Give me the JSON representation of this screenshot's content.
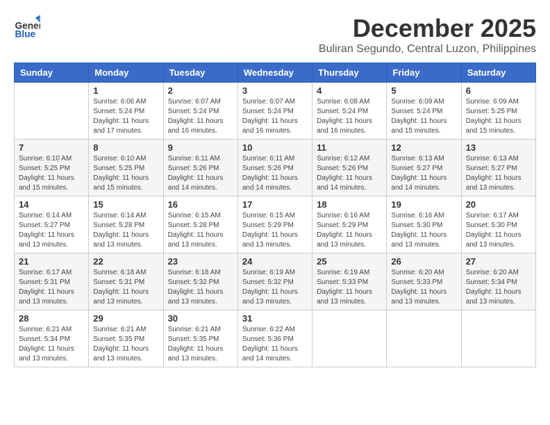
{
  "logo": {
    "line1": "General",
    "line2": "Blue"
  },
  "title": "December 2025",
  "subtitle": "Buliran Segundo, Central Luzon, Philippines",
  "headers": [
    "Sunday",
    "Monday",
    "Tuesday",
    "Wednesday",
    "Thursday",
    "Friday",
    "Saturday"
  ],
  "weeks": [
    [
      {
        "num": "",
        "info": ""
      },
      {
        "num": "1",
        "info": "Sunrise: 6:06 AM\nSunset: 5:24 PM\nDaylight: 11 hours\nand 17 minutes."
      },
      {
        "num": "2",
        "info": "Sunrise: 6:07 AM\nSunset: 5:24 PM\nDaylight: 11 hours\nand 16 minutes."
      },
      {
        "num": "3",
        "info": "Sunrise: 6:07 AM\nSunset: 5:24 PM\nDaylight: 11 hours\nand 16 minutes."
      },
      {
        "num": "4",
        "info": "Sunrise: 6:08 AM\nSunset: 5:24 PM\nDaylight: 11 hours\nand 16 minutes."
      },
      {
        "num": "5",
        "info": "Sunrise: 6:09 AM\nSunset: 5:24 PM\nDaylight: 11 hours\nand 15 minutes."
      },
      {
        "num": "6",
        "info": "Sunrise: 6:09 AM\nSunset: 5:25 PM\nDaylight: 11 hours\nand 15 minutes."
      }
    ],
    [
      {
        "num": "7",
        "info": "Sunrise: 6:10 AM\nSunset: 5:25 PM\nDaylight: 11 hours\nand 15 minutes."
      },
      {
        "num": "8",
        "info": "Sunrise: 6:10 AM\nSunset: 5:25 PM\nDaylight: 11 hours\nand 15 minutes."
      },
      {
        "num": "9",
        "info": "Sunrise: 6:11 AM\nSunset: 5:26 PM\nDaylight: 11 hours\nand 14 minutes."
      },
      {
        "num": "10",
        "info": "Sunrise: 6:11 AM\nSunset: 5:26 PM\nDaylight: 11 hours\nand 14 minutes."
      },
      {
        "num": "11",
        "info": "Sunrise: 6:12 AM\nSunset: 5:26 PM\nDaylight: 11 hours\nand 14 minutes."
      },
      {
        "num": "12",
        "info": "Sunrise: 6:13 AM\nSunset: 5:27 PM\nDaylight: 11 hours\nand 14 minutes."
      },
      {
        "num": "13",
        "info": "Sunrise: 6:13 AM\nSunset: 5:27 PM\nDaylight: 11 hours\nand 13 minutes."
      }
    ],
    [
      {
        "num": "14",
        "info": "Sunrise: 6:14 AM\nSunset: 5:27 PM\nDaylight: 11 hours\nand 13 minutes."
      },
      {
        "num": "15",
        "info": "Sunrise: 6:14 AM\nSunset: 5:28 PM\nDaylight: 11 hours\nand 13 minutes."
      },
      {
        "num": "16",
        "info": "Sunrise: 6:15 AM\nSunset: 5:28 PM\nDaylight: 11 hours\nand 13 minutes."
      },
      {
        "num": "17",
        "info": "Sunrise: 6:15 AM\nSunset: 5:29 PM\nDaylight: 11 hours\nand 13 minutes."
      },
      {
        "num": "18",
        "info": "Sunrise: 6:16 AM\nSunset: 5:29 PM\nDaylight: 11 hours\nand 13 minutes."
      },
      {
        "num": "19",
        "info": "Sunrise: 6:16 AM\nSunset: 5:30 PM\nDaylight: 11 hours\nand 13 minutes."
      },
      {
        "num": "20",
        "info": "Sunrise: 6:17 AM\nSunset: 5:30 PM\nDaylight: 11 hours\nand 13 minutes."
      }
    ],
    [
      {
        "num": "21",
        "info": "Sunrise: 6:17 AM\nSunset: 5:31 PM\nDaylight: 11 hours\nand 13 minutes."
      },
      {
        "num": "22",
        "info": "Sunrise: 6:18 AM\nSunset: 5:31 PM\nDaylight: 11 hours\nand 13 minutes."
      },
      {
        "num": "23",
        "info": "Sunrise: 6:18 AM\nSunset: 5:32 PM\nDaylight: 11 hours\nand 13 minutes."
      },
      {
        "num": "24",
        "info": "Sunrise: 6:19 AM\nSunset: 5:32 PM\nDaylight: 11 hours\nand 13 minutes."
      },
      {
        "num": "25",
        "info": "Sunrise: 6:19 AM\nSunset: 5:33 PM\nDaylight: 11 hours\nand 13 minutes."
      },
      {
        "num": "26",
        "info": "Sunrise: 6:20 AM\nSunset: 5:33 PM\nDaylight: 11 hours\nand 13 minutes."
      },
      {
        "num": "27",
        "info": "Sunrise: 6:20 AM\nSunset: 5:34 PM\nDaylight: 11 hours\nand 13 minutes."
      }
    ],
    [
      {
        "num": "28",
        "info": "Sunrise: 6:21 AM\nSunset: 5:34 PM\nDaylight: 11 hours\nand 13 minutes."
      },
      {
        "num": "29",
        "info": "Sunrise: 6:21 AM\nSunset: 5:35 PM\nDaylight: 11 hours\nand 13 minutes."
      },
      {
        "num": "30",
        "info": "Sunrise: 6:21 AM\nSunset: 5:35 PM\nDaylight: 11 hours\nand 13 minutes."
      },
      {
        "num": "31",
        "info": "Sunrise: 6:22 AM\nSunset: 5:36 PM\nDaylight: 11 hours\nand 14 minutes."
      },
      {
        "num": "",
        "info": ""
      },
      {
        "num": "",
        "info": ""
      },
      {
        "num": "",
        "info": ""
      }
    ]
  ]
}
